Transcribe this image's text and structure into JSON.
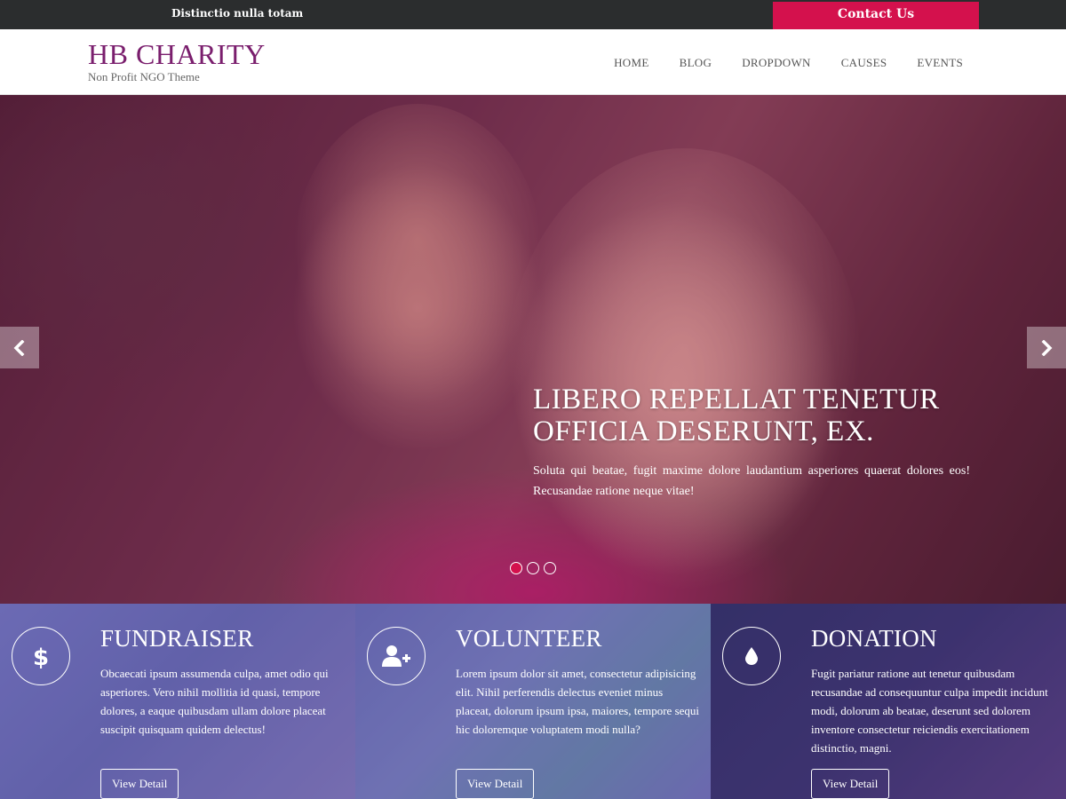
{
  "topbar": {
    "tagline": "Distinctio nulla totam",
    "contact_label": "Contact Us"
  },
  "header": {
    "logo_title": "HB CHARITY",
    "logo_subtitle": "Non Profit NGO Theme",
    "nav": [
      "HOME",
      "BLOG",
      "DROPDOWN",
      "CAUSES",
      "EVENTS"
    ]
  },
  "hero": {
    "title_line1": "LIBERO REPELLAT TENETUR",
    "title_line2": "OFFICIA DESERUNT, EX.",
    "text": "Soluta qui beatae, fugit maxime dolore laudantium asperiores quaerat dolores eos! Recusandae ratione neque vitae!",
    "prev_icon": "chevron-left-icon",
    "next_icon": "chevron-right-icon",
    "slide_count": 3,
    "active_slide": 1
  },
  "features": [
    {
      "icon": "dollar-icon",
      "title": "FUNDRAISER",
      "text": "Obcaecati ipsum assumenda culpa, amet odio qui asperiores. Vero nihil mollitia id quasi, tempore dolores, a eaque quibusdam ullam dolore placeat suscipit quisquam quidem delectus!",
      "button": "View Detail"
    },
    {
      "icon": "add-user-icon",
      "title": "VOLUNTEER",
      "text": "Lorem ipsum dolor sit amet, consectetur adipisicing elit. Nihil perferendis delectus eveniet minus placeat, dolorum ipsum ipsa, maiores, tempore sequi hic doloremque voluptatem modi nulla?",
      "button": "View Detail"
    },
    {
      "icon": "drop-icon",
      "title": "DONATION",
      "text": "Fugit pariatur ratione aut tenetur quibusdam recusandae ad consequuntur culpa impedit incidunt modi, dolorum ab beatae, deserunt sed dolorem inventore consectetur reiciendis exercitationem distinctio, magni.",
      "button": "View Detail"
    }
  ],
  "colors": {
    "brand": "#7a1e6d",
    "accent": "#d4114d",
    "topbar": "#2b2d2e"
  }
}
